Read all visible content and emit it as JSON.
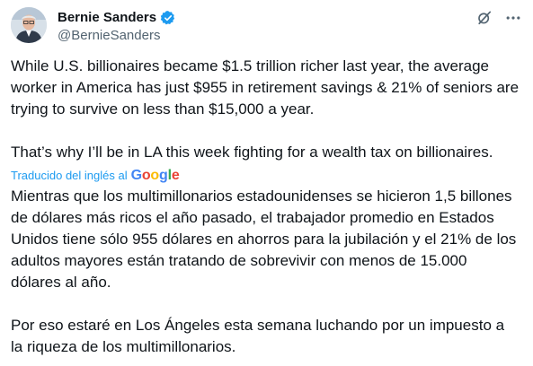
{
  "author": {
    "display_name": "Bernie Sanders",
    "handle": "@BernieSanders"
  },
  "icons": {
    "verified": "verified-badge-icon",
    "grok": "grok-icon",
    "more": "more-icon"
  },
  "colors": {
    "text": "#0f1419",
    "secondary": "#536471",
    "link": "#1d9bf0",
    "verified": "#1d9bf0"
  },
  "post": {
    "original_paragraphs": [
      "While U.S. billionaires became $1.5 trillion richer last year, the average worker in America has just $955 in retirement savings & 21% of seniors are trying to survive on less than $15,000 a year.",
      "That’s why I’ll be in LA this week fighting for a wealth tax on billionaires."
    ],
    "translation_label": "Traducido del inglés al",
    "translation_provider": "Google",
    "translated_paragraphs": [
      "Mientras que los multimillonarios estadounidenses se hicieron 1,5 billones de dólares más ricos el año pasado, el trabajador promedio en Estados Unidos tiene sólo 955 dólares en ahorros para la jubilación y el 21% de los adultos mayores están tratando de sobrevivir con menos de 15.000 dólares al año.",
      "Por eso estaré en Los Ángeles esta semana luchando por un impuesto a la riqueza de los multimillonarios."
    ]
  }
}
